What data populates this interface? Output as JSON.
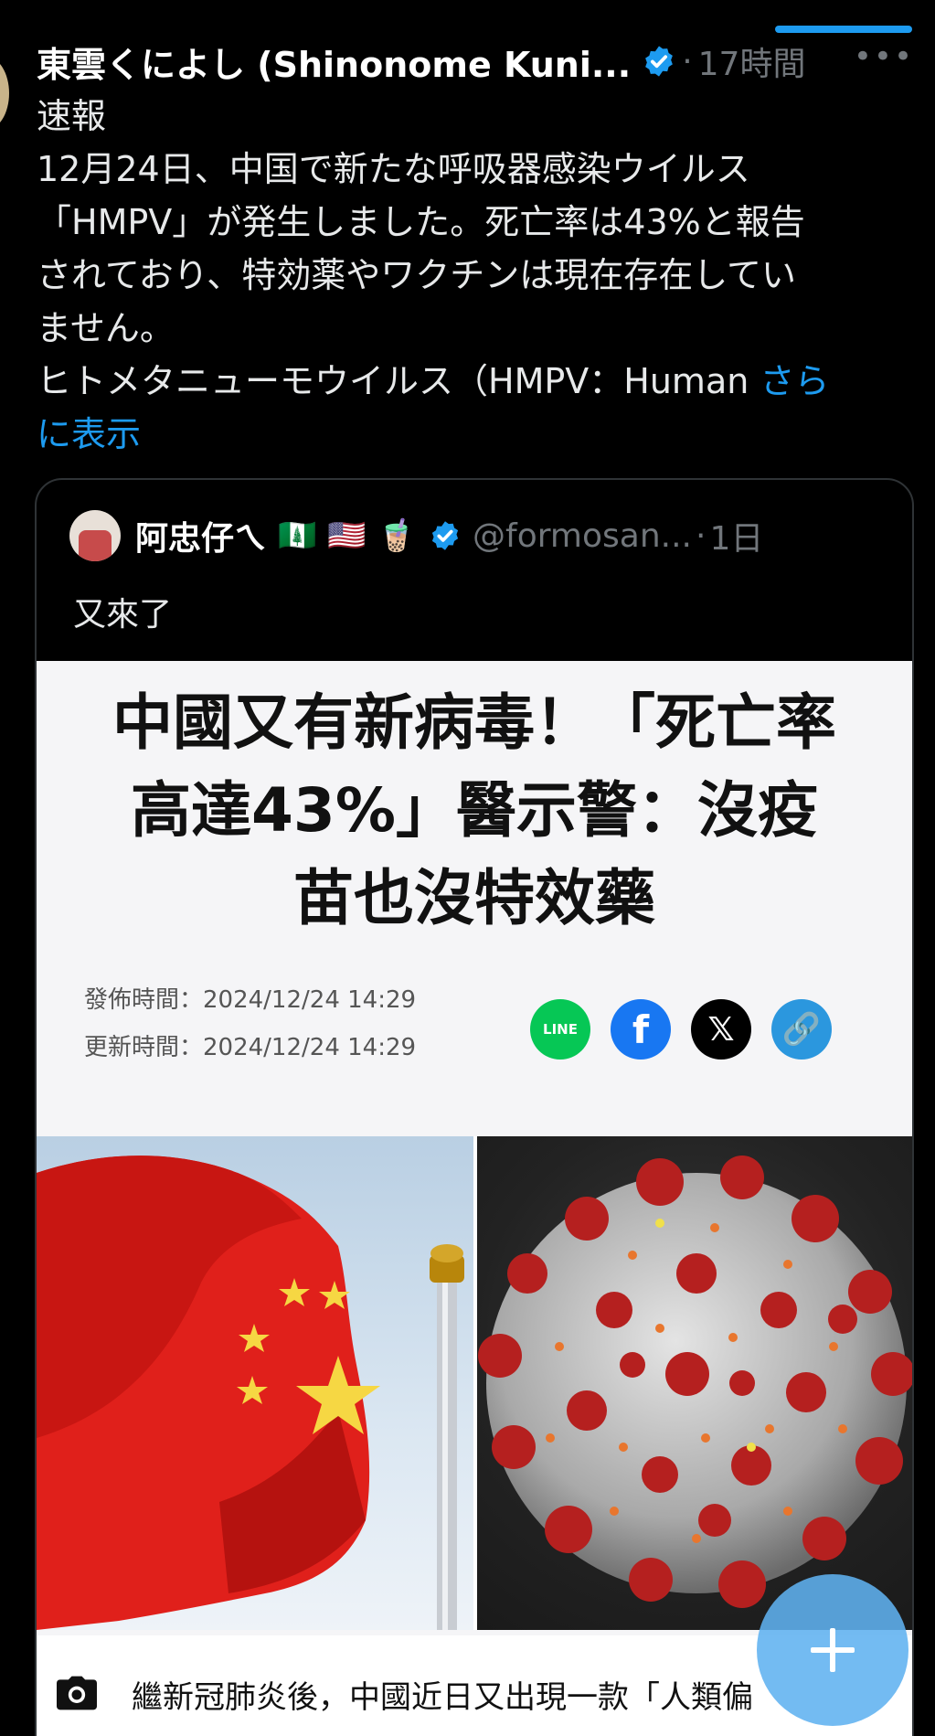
{
  "tweet": {
    "author_name": "東雲くによし (Shinonome Kuni...",
    "separator": "·",
    "time": "17時間",
    "more": "•••",
    "text_lines": [
      "速報",
      "12月24日、中国で新たな呼吸器感染ウイルス",
      "「HMPV」が発生しました。死亡率は43%と報告",
      "されており、特効薬やワクチンは現在存在してい",
      "ません。",
      "ヒトメタニューモウイルス（HMPV：Human "
    ],
    "show_more_1": "さら",
    "show_more_2": "に表示"
  },
  "quote": {
    "name": "阿忠仔ㄟ",
    "flags": [
      "🇳🇫",
      "🇺🇸",
      "🧋"
    ],
    "handle": "@formosan...",
    "separator": "·",
    "time": "1日",
    "text": "又來了"
  },
  "article": {
    "headline_lines": [
      "中國又有新病毒！「死亡率",
      "高達43%」醫示警：沒疫",
      "苗也沒特效藥"
    ],
    "published_label": "發佈時間：2024/12/24 14:29",
    "updated_label": "更新時間：2024/12/24 14:29",
    "share_line": "LINE",
    "share_fb": "f",
    "share_x": "𝕏",
    "share_link": "🔗",
    "caption": "繼新冠肺炎後，中國近日又出現一款「人類偏"
  },
  "colors": {
    "accent": "#1d9bf0",
    "background": "#000000",
    "muted": "#71767b"
  }
}
